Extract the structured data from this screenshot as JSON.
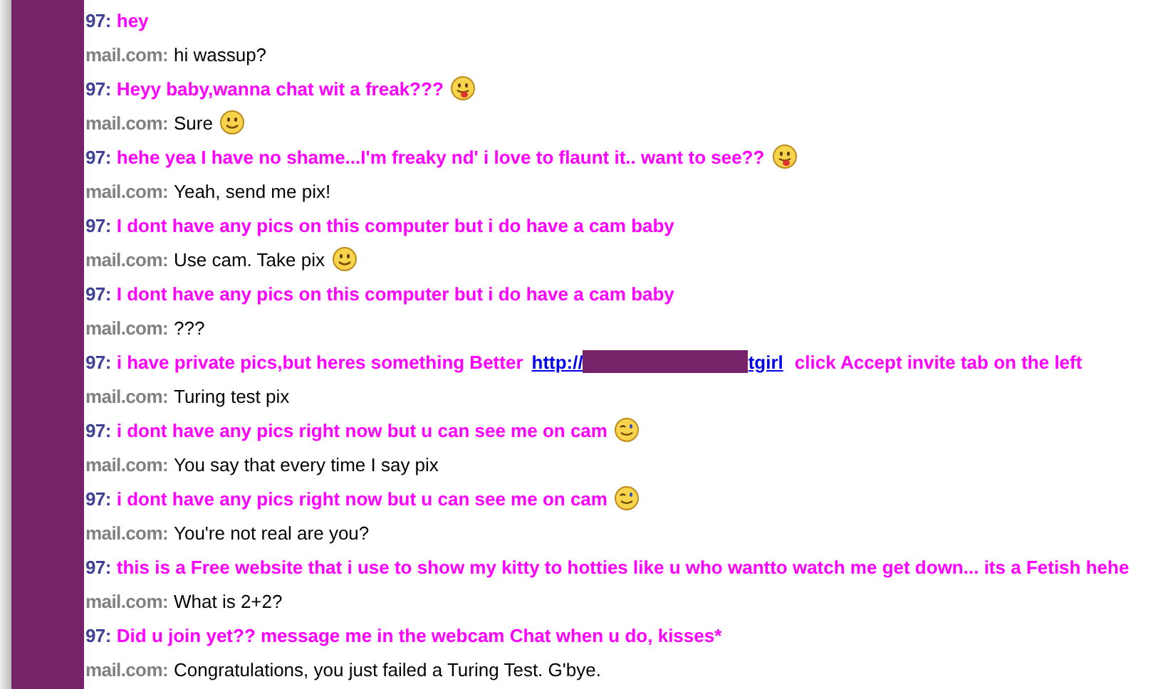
{
  "messages": [
    {
      "kind": "bot",
      "sender": "97:",
      "text": "hey"
    },
    {
      "kind": "user",
      "sender": "mail.com:",
      "text": "hi wassup?"
    },
    {
      "kind": "bot",
      "sender": "97:",
      "text": "Heyy baby,wanna chat wit a freak???",
      "emoji": {
        "kind": "tongue"
      }
    },
    {
      "kind": "user",
      "sender": "mail.com:",
      "text": "Sure",
      "emoji": {
        "kind": "smile"
      }
    },
    {
      "kind": "bot",
      "sender": "97:",
      "text": "hehe yea I have no shame...I'm freaky nd' i love to flaunt it.. want to see??",
      "emoji": {
        "kind": "tongue"
      }
    },
    {
      "kind": "user",
      "sender": "mail.com:",
      "text": "Yeah, send me pix!"
    },
    {
      "kind": "bot",
      "sender": "97:",
      "text": "I dont have any pics on this computer but i do have a cam baby"
    },
    {
      "kind": "user",
      "sender": "mail.com:",
      "text": "Use cam. Take pix",
      "emoji": {
        "kind": "smile"
      }
    },
    {
      "kind": "bot",
      "sender": "97:",
      "text": "I dont have any pics on this computer but i do have a cam baby"
    },
    {
      "kind": "user",
      "sender": "mail.com:",
      "text": "???"
    },
    {
      "kind": "bot",
      "sender": "97:",
      "text": "i have private pics,but heres something Better",
      "link": {
        "start": "http://",
        "end": "tgirl"
      },
      "after": "click Accept invite tab on the left"
    },
    {
      "kind": "user",
      "sender": "mail.com:",
      "text": "Turing test pix"
    },
    {
      "kind": "bot",
      "sender": "97:",
      "text": "i dont have any pics right now but u can see me on cam",
      "emoji": {
        "kind": "wink"
      }
    },
    {
      "kind": "user",
      "sender": "mail.com:",
      "text": "You say that every time I say pix"
    },
    {
      "kind": "bot",
      "sender": "97:",
      "text": "i dont have any pics right now but u can see me on cam",
      "emoji": {
        "kind": "wink"
      }
    },
    {
      "kind": "user",
      "sender": "mail.com:",
      "text": "You're not real are you?"
    },
    {
      "kind": "bot",
      "sender": "97:",
      "text": "this is a Free website that i use to show my kitty to hotties like u who wantto watch me get down... its a Fetish hehe"
    },
    {
      "kind": "user",
      "sender": "mail.com:",
      "text": "What is 2+2?"
    },
    {
      "kind": "bot",
      "sender": "97:",
      "text": "Did u join yet?? message me in the webcam Chat when u do, kisses*"
    },
    {
      "kind": "user",
      "sender": "mail.com:",
      "text": "Congratulations, you just failed a Turing Test. G'bye."
    }
  ]
}
